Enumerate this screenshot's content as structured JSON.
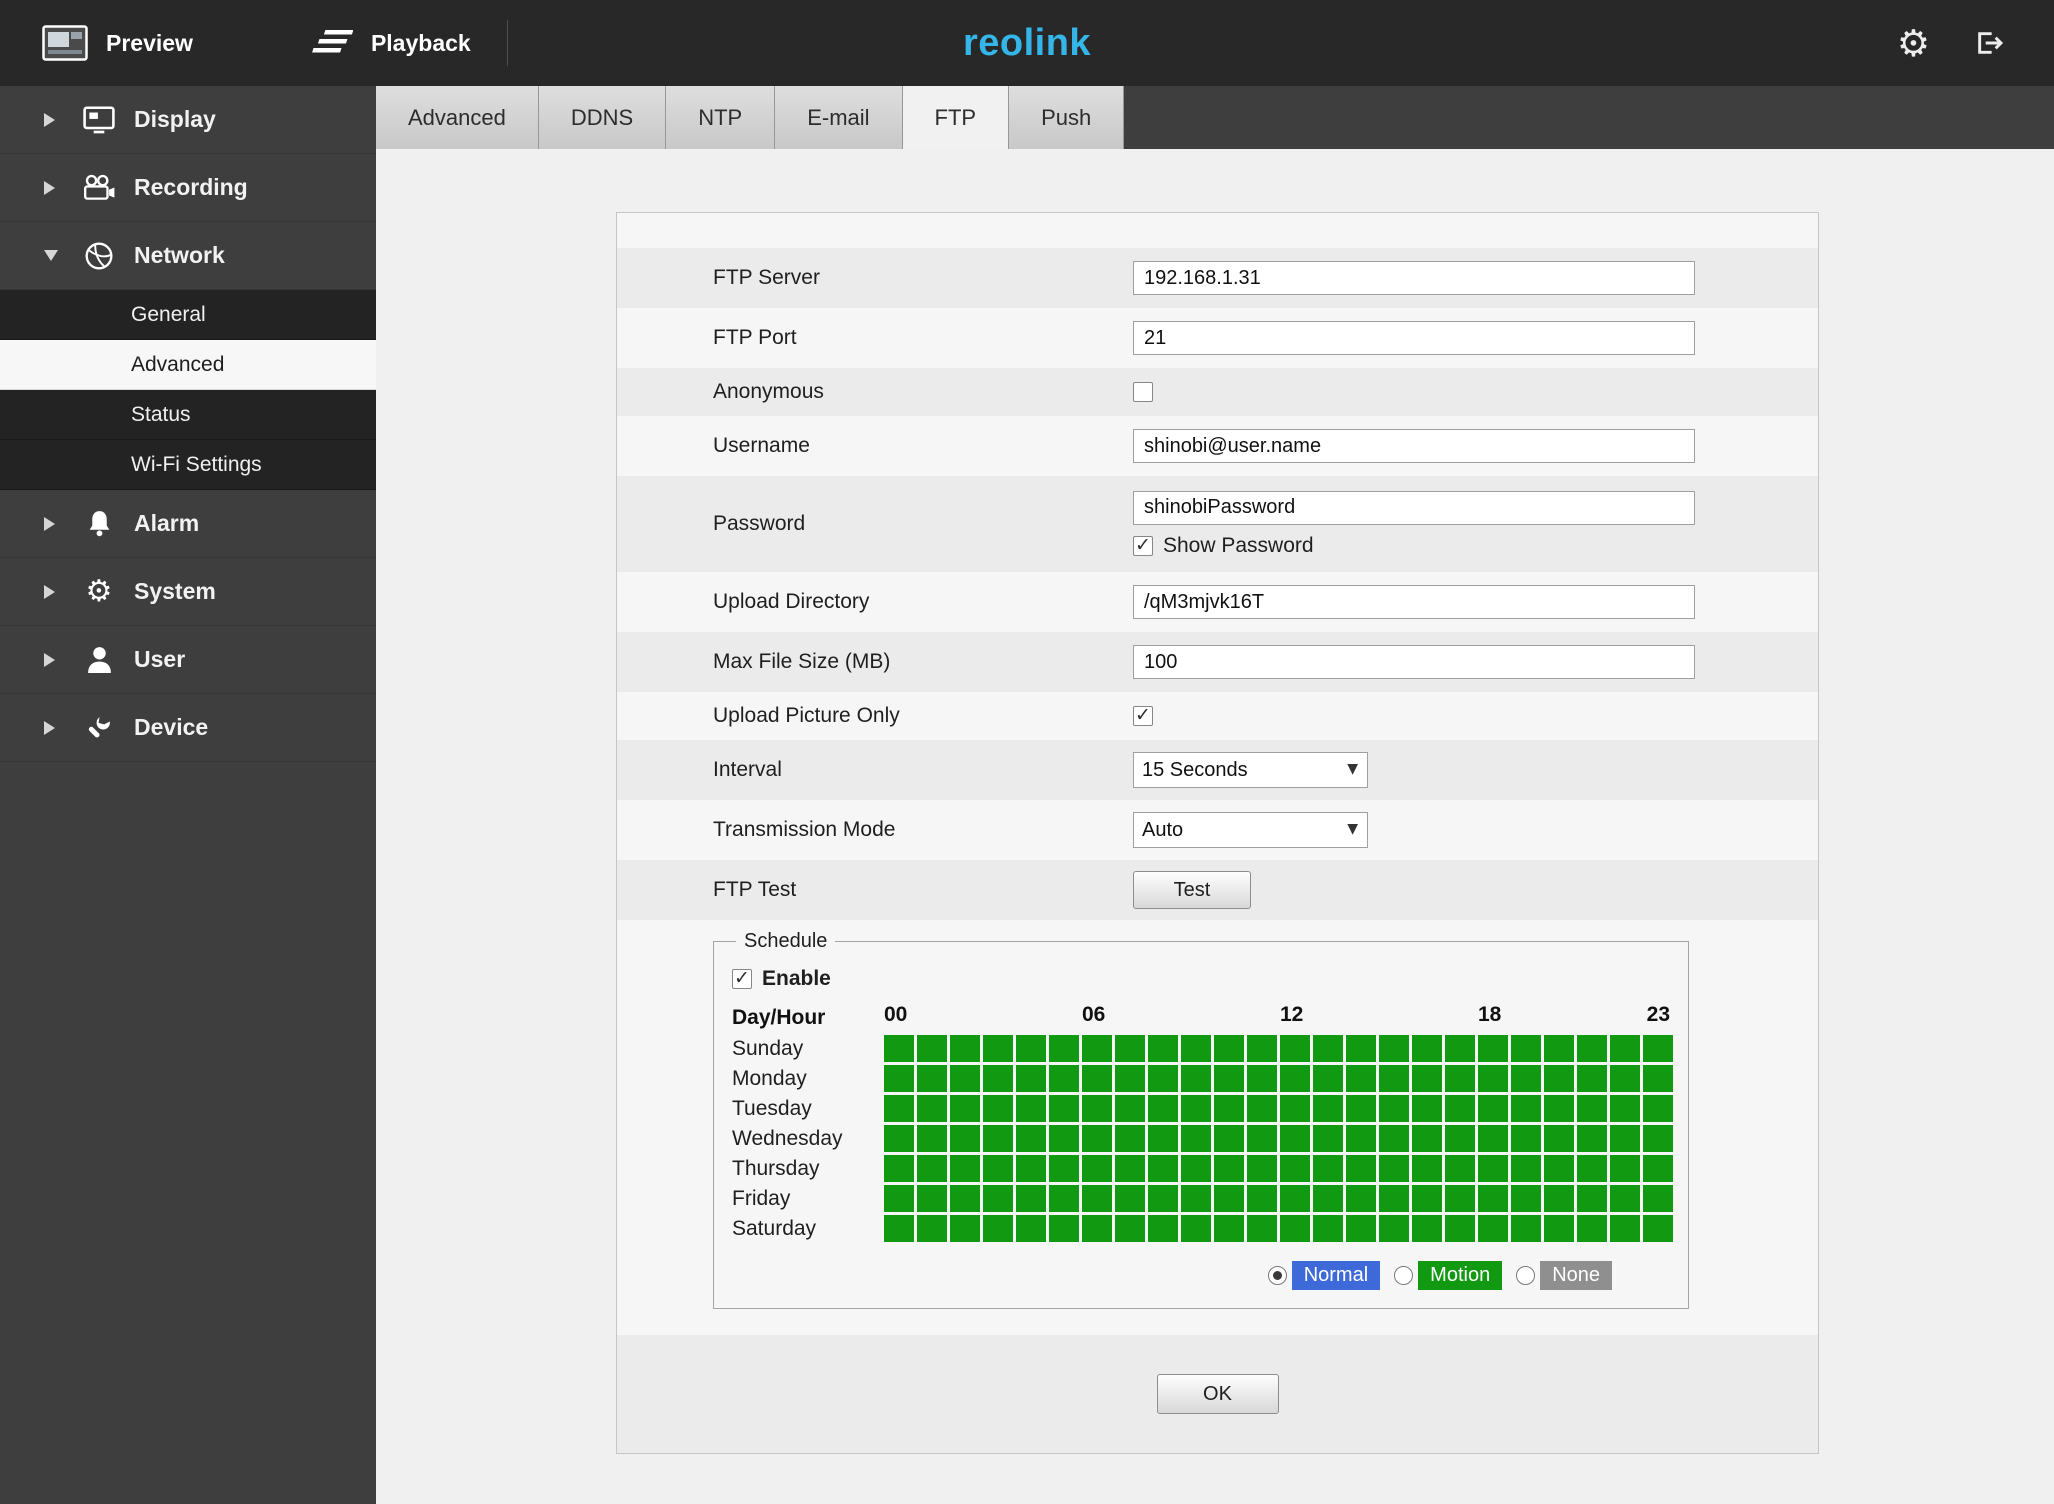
{
  "topbar": {
    "preview_label": "Preview",
    "playback_label": "Playback",
    "logo_text": "reolink",
    "logo_color": "#35b6e9"
  },
  "sidebar": {
    "items": [
      {
        "label": "Display"
      },
      {
        "label": "Recording"
      },
      {
        "label": "Network"
      },
      {
        "label": "Alarm"
      },
      {
        "label": "System"
      },
      {
        "label": "User"
      },
      {
        "label": "Device"
      }
    ],
    "network_children": [
      {
        "label": "General",
        "active": false
      },
      {
        "label": "Advanced",
        "active": true
      },
      {
        "label": "Status",
        "active": false
      },
      {
        "label": "Wi-Fi Settings",
        "active": false
      }
    ]
  },
  "tabs": [
    {
      "label": "Advanced",
      "active": false
    },
    {
      "label": "DDNS",
      "active": false
    },
    {
      "label": "NTP",
      "active": false
    },
    {
      "label": "E-mail",
      "active": false
    },
    {
      "label": "FTP",
      "active": true
    },
    {
      "label": "Push",
      "active": false
    }
  ],
  "form": {
    "ftp_server": {
      "label": "FTP Server",
      "value": "192.168.1.31"
    },
    "ftp_port": {
      "label": "FTP Port",
      "value": "21"
    },
    "anonymous": {
      "label": "Anonymous",
      "checked": false
    },
    "username": {
      "label": "Username",
      "value": "shinobi@user.name"
    },
    "password": {
      "label": "Password",
      "value": "shinobiPassword",
      "show_password_label": "Show Password",
      "show_password_checked": true
    },
    "upload_directory": {
      "label": "Upload Directory",
      "value": "/qM3mjvk16T"
    },
    "max_file_size": {
      "label": "Max File Size (MB)",
      "value": "100"
    },
    "upload_picture_only": {
      "label": "Upload Picture Only",
      "checked": true
    },
    "interval": {
      "label": "Interval",
      "value": "15 Seconds"
    },
    "transmission_mode": {
      "label": "Transmission Mode",
      "value": "Auto"
    },
    "ftp_test": {
      "label": "FTP Test",
      "button_label": "Test"
    },
    "ok_label": "OK"
  },
  "schedule": {
    "legend": "Schedule",
    "enable_label": "Enable",
    "enable_checked": true,
    "day_hour_label": "Day/Hour",
    "hour_marks": [
      {
        "label": "00",
        "col": 0
      },
      {
        "label": "06",
        "col": 6
      },
      {
        "label": "12",
        "col": 12
      },
      {
        "label": "18",
        "col": 18
      },
      {
        "label": "23",
        "col": 23
      }
    ],
    "days": [
      "Sunday",
      "Monday",
      "Tuesday",
      "Wednesday",
      "Thursday",
      "Friday",
      "Saturday"
    ],
    "cols": 24,
    "cell_state": "all-selected",
    "cell_color": "#129912",
    "modes": [
      {
        "label": "Normal",
        "color": "#3d6ad8",
        "selected": true
      },
      {
        "label": "Motion",
        "color": "#129912",
        "selected": false
      },
      {
        "label": "None",
        "color": "#8f8f8f",
        "selected": false
      }
    ]
  }
}
